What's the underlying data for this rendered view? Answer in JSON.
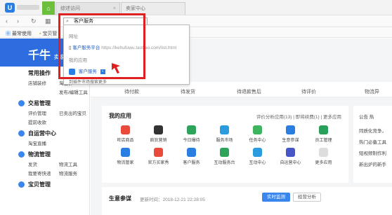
{
  "tabbar": {
    "app_logo_letter": "U",
    "tabs": [
      {
        "label": "综述访问"
      },
      {
        "label": "卖家中心"
      }
    ]
  },
  "nav": {
    "address_value": "客户服务"
  },
  "bookmarks": [
    {
      "label": "最常使用"
    },
    {
      "label": "宝贝管"
    }
  ],
  "sidebar": {
    "brand": "千牛",
    "brand_sub": "卖家",
    "groups": [
      {
        "title": "常用操作",
        "links": [
          "店铺装修",
          "淘宝群",
          "",
          "发布/编辑工具"
        ]
      },
      {
        "title": "交易管理",
        "links": [
          "评价管理",
          "已卖出的宝贝",
          "提前收款",
          ""
        ]
      },
      {
        "title": "自运营中心",
        "links": [
          "淘宝直播",
          "",
          "",
          ""
        ]
      },
      {
        "title": "物流管理",
        "links": [
          "发货",
          "物流工具",
          "我要寄快递",
          "物流服务"
        ]
      },
      {
        "title": "宝贝管理",
        "links": []
      }
    ]
  },
  "main": {
    "stats": [
      "待付款",
      "待发货",
      "待退款售后",
      "待评价",
      "物流异"
    ],
    "myapps": {
      "title": "我的应用",
      "links": "评价分析应用(13) | 即将续费(1) | 更多应用",
      "apps": [
        {
          "label": "旺店商品",
          "color": "#e94a3b"
        },
        {
          "label": "疯狂营销",
          "color": "#333333"
        },
        {
          "label": "今日爆待",
          "color": "#2ea35a"
        },
        {
          "label": "服务市场",
          "color": "#2b9be0"
        },
        {
          "label": "任务中心",
          "color": "#3fb45f"
        },
        {
          "label": "生意参谋",
          "color": "#2a7de1"
        },
        {
          "label": "员工管理",
          "color": "#29a05a"
        },
        {
          "label": "物流管家",
          "color": "#2a7de1"
        },
        {
          "label": "官方买家秀",
          "color": "#e94a3b"
        },
        {
          "label": "客户服务",
          "color": "#2a7de1"
        },
        {
          "label": "互动服务台",
          "color": "#2ea35a"
        },
        {
          "label": "互动中心",
          "color": "#2b9be0"
        },
        {
          "label": "自运营中心",
          "color": "#4656c9"
        },
        {
          "label": "更多应用",
          "color": "#dddddd"
        }
      ]
    },
    "rightpanel": {
      "tabs": "公告   热",
      "lines": [
        "同质化竞争，",
        "热门必备工具",
        "短视频制作利",
        "新出炉的新手"
      ]
    },
    "biz": {
      "title": "生意参谋",
      "time": "更新时间：2018-12-21 22:28:05",
      "btn1": "实时监测",
      "btn2": "经营分析"
    }
  },
  "dropdown": {
    "section_url": "网址",
    "url_item_name": "客户服务平台",
    "url_item_url": "https://kehufuwu.taobao.com/list.html",
    "section_app": "我的应用",
    "app_item": "客户服务",
    "more": "到插件市场搜索更多"
  },
  "annotation_color": "#e02020"
}
